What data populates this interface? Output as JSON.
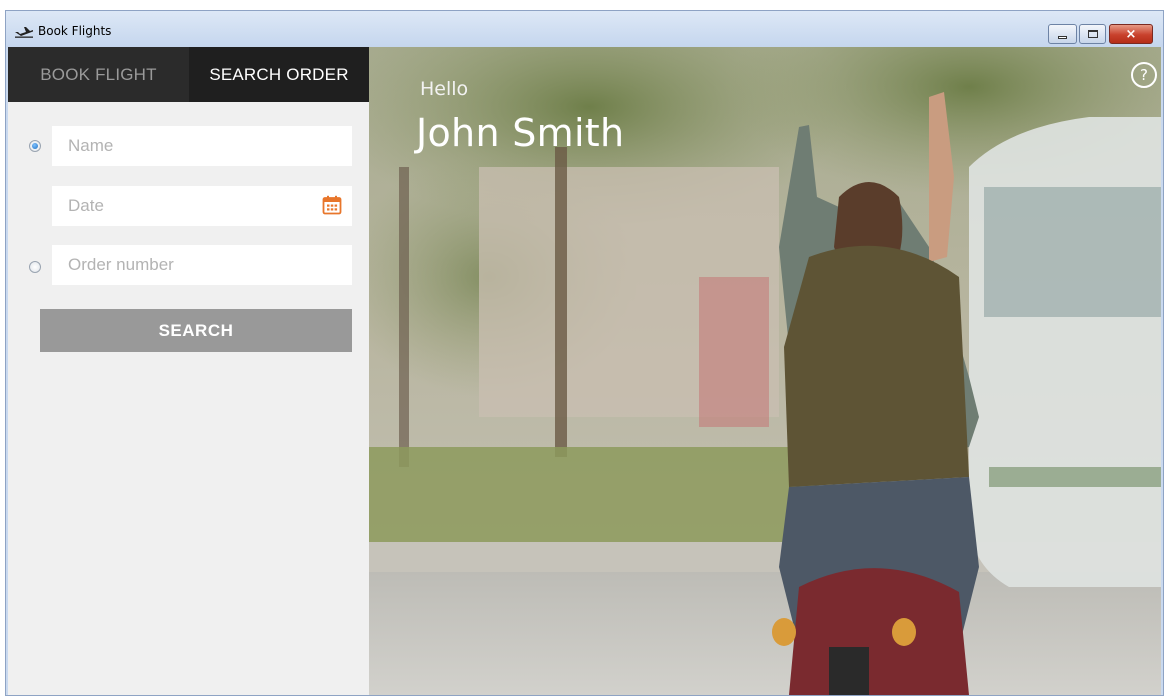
{
  "window": {
    "title": "Book Flights",
    "app_icon": "airplane-takeoff-icon",
    "controls": {
      "minimize": "minimize-icon",
      "maximize": "maximize-icon",
      "close": "×"
    }
  },
  "tabs": [
    {
      "label": "BOOK FLIGHT",
      "active": false
    },
    {
      "label": "SEARCH ORDER",
      "active": true
    }
  ],
  "search_form": {
    "name_placeholder": "Name",
    "date_placeholder": "Date",
    "order_placeholder": "Order number",
    "search_by_name_selected": true,
    "search_by_order_selected": false,
    "calendar_icon": "calendar-icon",
    "search_label": "SEARCH"
  },
  "hero": {
    "greeting": "Hello",
    "user_name": "John Smith",
    "help_label": "?"
  },
  "colors": {
    "tab_bar": "#2b2b2b",
    "active_tab_text": "#ffffff",
    "inactive_tab_text": "#9a9a9a",
    "panel_bg": "#f0f0f0",
    "search_button": "#999999",
    "calendar_accent": "#e8762b"
  }
}
